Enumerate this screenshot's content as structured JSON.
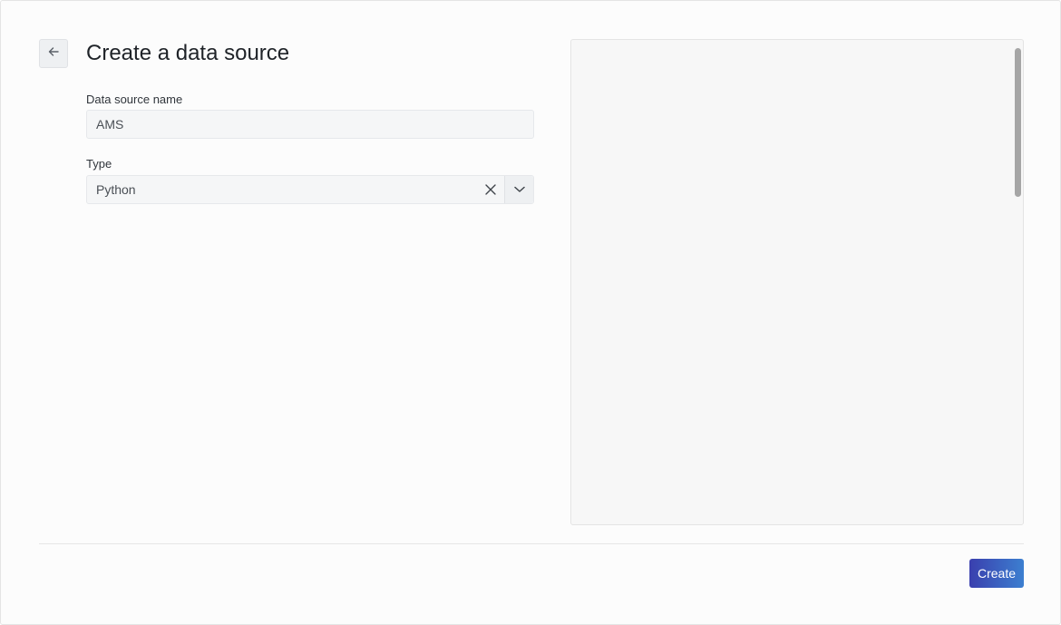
{
  "header": {
    "title": "Create a data source",
    "back_icon": "arrow-left-icon"
  },
  "form": {
    "name_label": "Data source name",
    "name_value": "AMS",
    "type_label": "Type",
    "type_value": "Python",
    "clear_icon": "close-icon",
    "toggle_icon": "chevron-down-icon"
  },
  "preview": {
    "content": ""
  },
  "footer": {
    "create_label": "Create"
  },
  "colors": {
    "accent_start": "#3a3fae",
    "accent_end": "#3c7fd0",
    "panel_bg": "#f7f7f7"
  }
}
